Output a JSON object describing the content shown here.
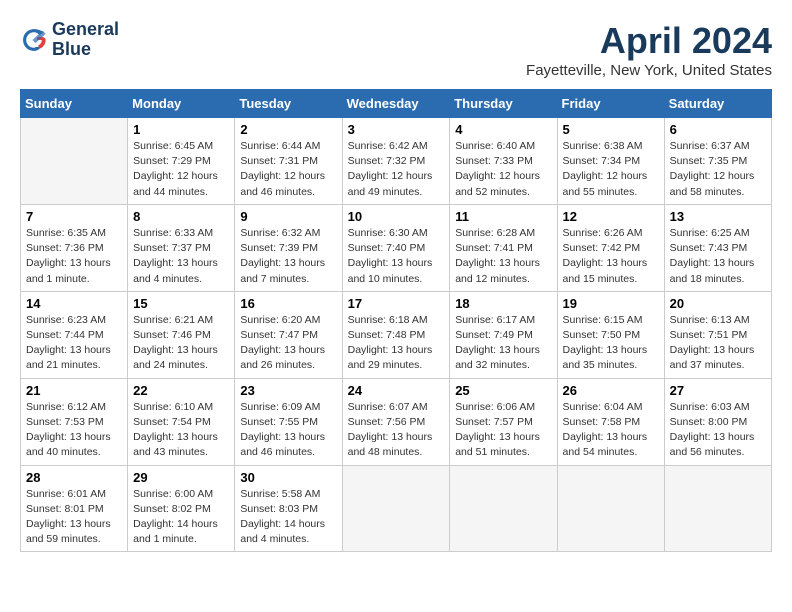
{
  "logo": {
    "line1": "General",
    "line2": "Blue"
  },
  "title": "April 2024",
  "subtitle": "Fayetteville, New York, United States",
  "days_of_week": [
    "Sunday",
    "Monday",
    "Tuesday",
    "Wednesday",
    "Thursday",
    "Friday",
    "Saturday"
  ],
  "weeks": [
    [
      null,
      {
        "day": 1,
        "sunrise": "6:45 AM",
        "sunset": "7:29 PM",
        "daylight": "12 hours and 44 minutes."
      },
      {
        "day": 2,
        "sunrise": "6:44 AM",
        "sunset": "7:31 PM",
        "daylight": "12 hours and 46 minutes."
      },
      {
        "day": 3,
        "sunrise": "6:42 AM",
        "sunset": "7:32 PM",
        "daylight": "12 hours and 49 minutes."
      },
      {
        "day": 4,
        "sunrise": "6:40 AM",
        "sunset": "7:33 PM",
        "daylight": "12 hours and 52 minutes."
      },
      {
        "day": 5,
        "sunrise": "6:38 AM",
        "sunset": "7:34 PM",
        "daylight": "12 hours and 55 minutes."
      },
      {
        "day": 6,
        "sunrise": "6:37 AM",
        "sunset": "7:35 PM",
        "daylight": "12 hours and 58 minutes."
      }
    ],
    [
      {
        "day": 7,
        "sunrise": "6:35 AM",
        "sunset": "7:36 PM",
        "daylight": "13 hours and 1 minute."
      },
      {
        "day": 8,
        "sunrise": "6:33 AM",
        "sunset": "7:37 PM",
        "daylight": "13 hours and 4 minutes."
      },
      {
        "day": 9,
        "sunrise": "6:32 AM",
        "sunset": "7:39 PM",
        "daylight": "13 hours and 7 minutes."
      },
      {
        "day": 10,
        "sunrise": "6:30 AM",
        "sunset": "7:40 PM",
        "daylight": "13 hours and 10 minutes."
      },
      {
        "day": 11,
        "sunrise": "6:28 AM",
        "sunset": "7:41 PM",
        "daylight": "13 hours and 12 minutes."
      },
      {
        "day": 12,
        "sunrise": "6:26 AM",
        "sunset": "7:42 PM",
        "daylight": "13 hours and 15 minutes."
      },
      {
        "day": 13,
        "sunrise": "6:25 AM",
        "sunset": "7:43 PM",
        "daylight": "13 hours and 18 minutes."
      }
    ],
    [
      {
        "day": 14,
        "sunrise": "6:23 AM",
        "sunset": "7:44 PM",
        "daylight": "13 hours and 21 minutes."
      },
      {
        "day": 15,
        "sunrise": "6:21 AM",
        "sunset": "7:46 PM",
        "daylight": "13 hours and 24 minutes."
      },
      {
        "day": 16,
        "sunrise": "6:20 AM",
        "sunset": "7:47 PM",
        "daylight": "13 hours and 26 minutes."
      },
      {
        "day": 17,
        "sunrise": "6:18 AM",
        "sunset": "7:48 PM",
        "daylight": "13 hours and 29 minutes."
      },
      {
        "day": 18,
        "sunrise": "6:17 AM",
        "sunset": "7:49 PM",
        "daylight": "13 hours and 32 minutes."
      },
      {
        "day": 19,
        "sunrise": "6:15 AM",
        "sunset": "7:50 PM",
        "daylight": "13 hours and 35 minutes."
      },
      {
        "day": 20,
        "sunrise": "6:13 AM",
        "sunset": "7:51 PM",
        "daylight": "13 hours and 37 minutes."
      }
    ],
    [
      {
        "day": 21,
        "sunrise": "6:12 AM",
        "sunset": "7:53 PM",
        "daylight": "13 hours and 40 minutes."
      },
      {
        "day": 22,
        "sunrise": "6:10 AM",
        "sunset": "7:54 PM",
        "daylight": "13 hours and 43 minutes."
      },
      {
        "day": 23,
        "sunrise": "6:09 AM",
        "sunset": "7:55 PM",
        "daylight": "13 hours and 46 minutes."
      },
      {
        "day": 24,
        "sunrise": "6:07 AM",
        "sunset": "7:56 PM",
        "daylight": "13 hours and 48 minutes."
      },
      {
        "day": 25,
        "sunrise": "6:06 AM",
        "sunset": "7:57 PM",
        "daylight": "13 hours and 51 minutes."
      },
      {
        "day": 26,
        "sunrise": "6:04 AM",
        "sunset": "7:58 PM",
        "daylight": "13 hours and 54 minutes."
      },
      {
        "day": 27,
        "sunrise": "6:03 AM",
        "sunset": "8:00 PM",
        "daylight": "13 hours and 56 minutes."
      }
    ],
    [
      {
        "day": 28,
        "sunrise": "6:01 AM",
        "sunset": "8:01 PM",
        "daylight": "13 hours and 59 minutes."
      },
      {
        "day": 29,
        "sunrise": "6:00 AM",
        "sunset": "8:02 PM",
        "daylight": "14 hours and 1 minute."
      },
      {
        "day": 30,
        "sunrise": "5:58 AM",
        "sunset": "8:03 PM",
        "daylight": "14 hours and 4 minutes."
      },
      null,
      null,
      null,
      null
    ]
  ]
}
